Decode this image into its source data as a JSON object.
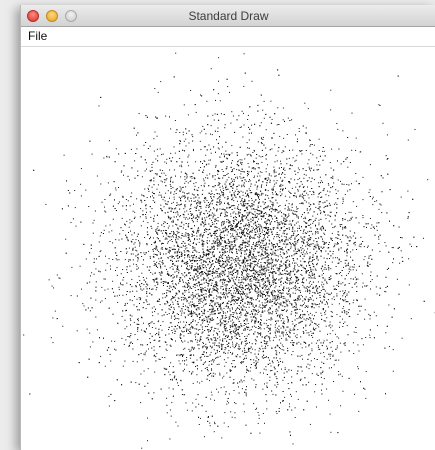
{
  "window": {
    "title": "Standard Draw"
  },
  "menu": {
    "file_label": "File"
  },
  "drawing": {
    "point_count": 9000,
    "point_color": "#111111"
  }
}
